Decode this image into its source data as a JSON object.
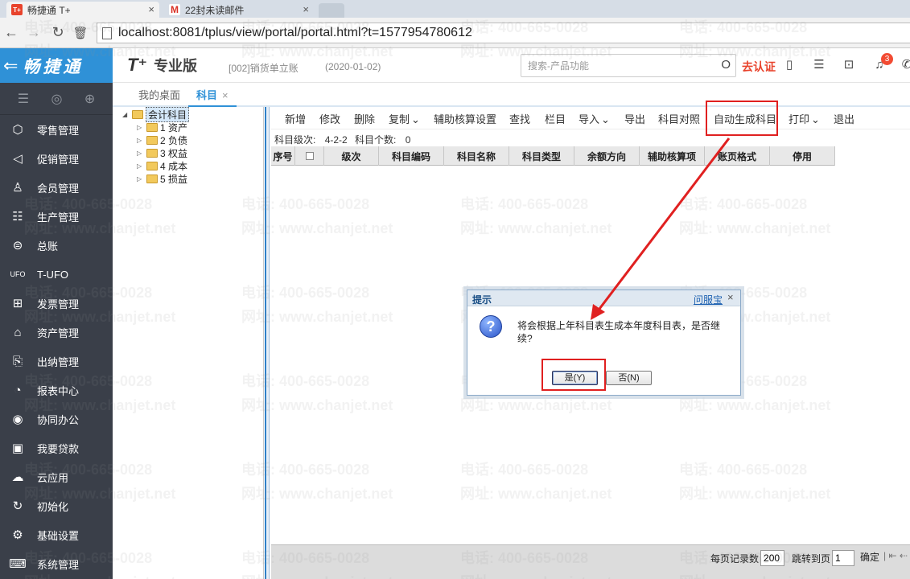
{
  "browser": {
    "tabs": [
      {
        "favicon": "T+",
        "favicon_color": "#e8432c",
        "title": "畅捷通 T+",
        "close": "×"
      },
      {
        "favicon": "M",
        "favicon_color": "#d93025",
        "title": "22封未读邮件",
        "close": "×"
      }
    ],
    "nav": {
      "back": "←",
      "forward": "→",
      "reload": "↻",
      "trash": "🗑"
    },
    "url": "localhost:8081/tplus/view/portal/portal.html?t=1577954780612"
  },
  "header": {
    "logo_text": "畅捷通",
    "logo_arrow": "⇐",
    "product": "T⁺",
    "edition": "专业版",
    "account": "[002]销货单立账",
    "date": "(2020-01-02)",
    "search_placeholder": "搜索-产品功能",
    "search_icon": "O",
    "certify": "去认证",
    "notification_count": "3",
    "brand_color": "#2f91d7",
    "accent_color": "#e8432c"
  },
  "sidebar": {
    "tools": [
      "☰",
      "◎",
      "⊕"
    ],
    "items": [
      {
        "icon": "⬡",
        "label": "零售管理"
      },
      {
        "icon": "◁",
        "label": "促销管理"
      },
      {
        "icon": "♙",
        "label": "会员管理"
      },
      {
        "icon": "☷",
        "label": "生产管理"
      },
      {
        "icon": "⊜",
        "label": "总账"
      },
      {
        "icon": "UFO",
        "label": "T-UFO"
      },
      {
        "icon": "⊞",
        "label": "发票管理"
      },
      {
        "icon": "⌂",
        "label": "资产管理"
      },
      {
        "icon": "⎘",
        "label": "出纳管理"
      },
      {
        "icon": "◔",
        "label": "报表中心"
      },
      {
        "icon": "◉",
        "label": "协同办公"
      },
      {
        "icon": "▣",
        "label": "我要贷款"
      },
      {
        "icon": "☁",
        "label": "云应用"
      },
      {
        "icon": "↻",
        "label": "初始化"
      },
      {
        "icon": "⚙",
        "label": "基础设置"
      },
      {
        "icon": "⌨",
        "label": "系统管理"
      }
    ]
  },
  "content_tabs": {
    "desk": "我的桌面",
    "active": "科目",
    "close": "×"
  },
  "tree": {
    "root": "会计科目",
    "children": [
      "1 资产",
      "2 负债",
      "3 权益",
      "4 成本",
      "5 损益"
    ]
  },
  "toolbar": {
    "buttons": [
      "新增",
      "修改",
      "删除",
      "复制",
      "辅助核算设置",
      "查找",
      "栏目",
      "导入",
      "导出",
      "科目对照",
      "自动生成科目",
      "打印",
      "退出"
    ],
    "dropdown_mark": "⌄"
  },
  "info": {
    "levels_label": "科目级次:",
    "levels_value": "4-2-2",
    "count_label": "科目个数:",
    "count_value": "0"
  },
  "grid": {
    "columns": [
      "序号",
      "",
      "级次",
      "科目编码",
      "科目名称",
      "科目类型",
      "余额方向",
      "辅助核算项",
      "账页格式",
      "停用"
    ]
  },
  "footer": {
    "per_page_label": "每页记录数",
    "per_page_value": "200",
    "jump_label": "跳转到页",
    "jump_value": "1",
    "confirm": "确定",
    "nav": "| ⇤ ⇠"
  },
  "watermark": {
    "phone": "电话: 400-665-0028",
    "site": "网址: www.chanjet.net"
  },
  "dialog": {
    "title": "提示",
    "help": "问服宝",
    "close": "×",
    "icon": "?",
    "message": "将会根据上年科目表生成本年度科目表，是否继续?",
    "yes": "是(Y)",
    "no": "否(N)"
  },
  "annotation_color": "#e02020"
}
